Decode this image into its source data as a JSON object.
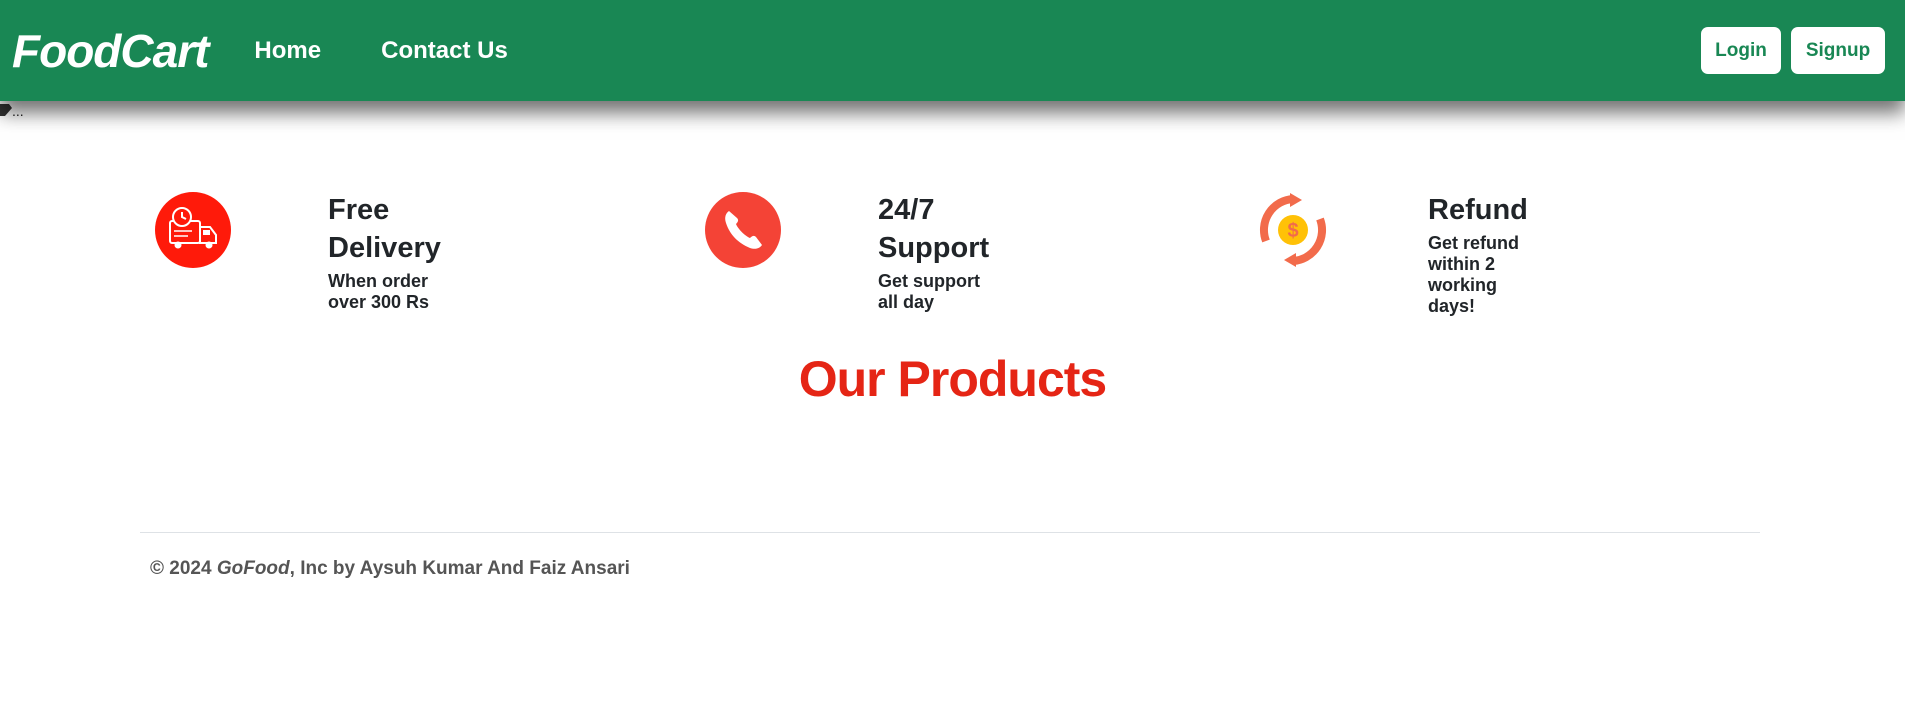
{
  "navbar": {
    "brand": "FoodCart",
    "links": [
      {
        "label": "Home"
      },
      {
        "label": "Contact Us"
      }
    ],
    "login_label": "Login",
    "signup_label": "Signup"
  },
  "broken_image_alt": "...",
  "features": [
    {
      "title": "Free Delivery",
      "subtitle": "When order over 300 Rs",
      "icon": "delivery-truck-icon"
    },
    {
      "title": "24/7 Support",
      "subtitle": "Get support all day",
      "icon": "phone-icon"
    },
    {
      "title": "Refund",
      "subtitle": "Get refund within 2 working days!",
      "icon": "refund-icon"
    }
  ],
  "products_title": "Our Products",
  "footer": {
    "prefix": "© 2024 ",
    "brand": "GoFood",
    "suffix": ", Inc by Aysuh Kumar And Faiz Ansari"
  },
  "colors": {
    "navbar": "#198754",
    "title_red": "#e52515",
    "icon_red": "#ff1a0a",
    "phone_red": "#f44336",
    "refund_orange": "#f26b4b",
    "coin_yellow": "#ffc107"
  }
}
